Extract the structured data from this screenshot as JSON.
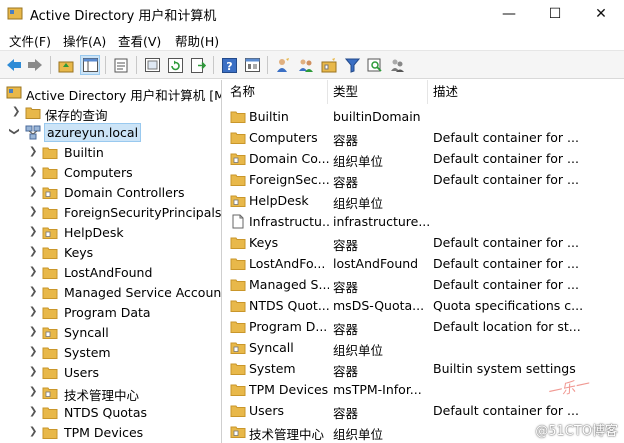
{
  "window": {
    "title": "Active Directory 用户和计算机",
    "minimize_glyph": "—",
    "maximize_glyph": "☐",
    "close_glyph": "✕"
  },
  "menu": [
    "文件(F)",
    "操作(A)",
    "查看(V)",
    "帮助(H)"
  ],
  "toolbar_icons": [
    "back-arrow-icon",
    "forward-arrow-icon",
    "up-folder-icon",
    "show-tree-icon",
    "properties-icon",
    "refresh-icon",
    "new-window-icon",
    "export-list-icon",
    "help-icon",
    "console-icon",
    "new-user-icon",
    "new-group-icon",
    "new-ou-icon",
    "filter-icon",
    "find-icon",
    "add-to-group-icon"
  ],
  "tree": {
    "root": "Active Directory 用户和计算机 [Ma",
    "saved_queries": "保存的查询",
    "domain": "azureyun.local",
    "children": [
      "Builtin",
      "Computers",
      "Domain Controllers",
      "ForeignSecurityPrincipals",
      "HelpDesk",
      "Keys",
      "LostAndFound",
      "Managed Service Accounts",
      "Program Data",
      "Syncall",
      "System",
      "Users",
      "技术管理中心",
      "NTDS Quotas",
      "TPM Devices"
    ],
    "child_types": [
      "folder",
      "folder",
      "ou",
      "folder",
      "ou",
      "folder",
      "folder",
      "folder",
      "folder",
      "ou",
      "folder",
      "folder",
      "ou",
      "folder",
      "folder"
    ]
  },
  "list": {
    "headers": [
      "名称",
      "类型",
      "描述"
    ],
    "rows": [
      {
        "name": "Builtin",
        "type": "builtinDomain",
        "desc": "",
        "icon": "folder"
      },
      {
        "name": "Computers",
        "type": "容器",
        "desc": "Default container for ...",
        "icon": "folder"
      },
      {
        "name": "Domain Co...",
        "type": "组织单位",
        "desc": "Default container for ...",
        "icon": "ou"
      },
      {
        "name": "ForeignSec...",
        "type": "容器",
        "desc": "Default container for ...",
        "icon": "folder"
      },
      {
        "name": "HelpDesk",
        "type": "组织单位",
        "desc": "",
        "icon": "ou"
      },
      {
        "name": "Infrastructu...",
        "type": "infrastructure...",
        "desc": "",
        "icon": "doc"
      },
      {
        "name": "Keys",
        "type": "容器",
        "desc": "Default container for ...",
        "icon": "folder"
      },
      {
        "name": "LostAndFo...",
        "type": "lostAndFound",
        "desc": "Default container for ...",
        "icon": "folder"
      },
      {
        "name": "Managed S...",
        "type": "容器",
        "desc": "Default container for ...",
        "icon": "folder"
      },
      {
        "name": "NTDS Quot...",
        "type": "msDS-Quota...",
        "desc": "Quota specifications c...",
        "icon": "folder"
      },
      {
        "name": "Program D...",
        "type": "容器",
        "desc": "Default location for st...",
        "icon": "folder"
      },
      {
        "name": "Syncall",
        "type": "组织单位",
        "desc": "",
        "icon": "ou"
      },
      {
        "name": "System",
        "type": "容器",
        "desc": "Builtin system settings",
        "icon": "folder"
      },
      {
        "name": "TPM Devices",
        "type": "msTPM-Infor...",
        "desc": "",
        "icon": "folder"
      },
      {
        "name": "Users",
        "type": "容器",
        "desc": "Default container for ...",
        "icon": "folder"
      },
      {
        "name": "技术管理中心",
        "type": "组织单位",
        "desc": "",
        "icon": "ou"
      }
    ]
  },
  "watermark": "@51CTO博客",
  "colors": {
    "folder": "#e8b84a",
    "folder_dark": "#c9962a",
    "selection": "#cce4f7"
  }
}
